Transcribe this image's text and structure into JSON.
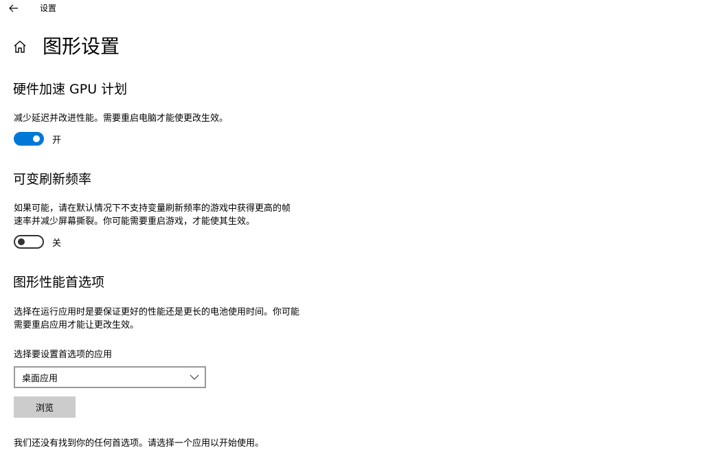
{
  "window": {
    "app_title": "设置"
  },
  "page": {
    "title": "图形设置"
  },
  "gpu_scheduling": {
    "title": "硬件加速 GPU 计划",
    "description": "减少延迟并改进性能。需要重启电脑才能使更改生效。",
    "toggle_state": "on",
    "toggle_label": "开"
  },
  "variable_refresh": {
    "title": "可变刷新频率",
    "description_line1": "如果可能，请在默认情况下不支持变量刷新频率的游戏中获得更高的帧",
    "description_line2": "速率并减少屏幕撕裂。你可能需要重启游戏，才能使其生效。",
    "toggle_state": "off",
    "toggle_label": "关"
  },
  "graphics_preference": {
    "title": "图形性能首选项",
    "description_line1": "选择在运行应用时是要保证更好的性能还是更长的电池使用时间。你可能",
    "description_line2": "需要重启应用才能让更改生效。",
    "select_label": "选择要设置首选项的应用",
    "select_value": "桌面应用",
    "browse_label": "浏览",
    "empty_message": "我们还没有找到你的任何首选项。请选择一个应用以开始使用。"
  },
  "colors": {
    "accent": "#0078d7",
    "button_bg": "#cccccc",
    "select_border": "#999999"
  },
  "icons": {
    "back": "back-arrow-icon",
    "home": "home-icon",
    "dropdown": "chevron-down-icon"
  }
}
